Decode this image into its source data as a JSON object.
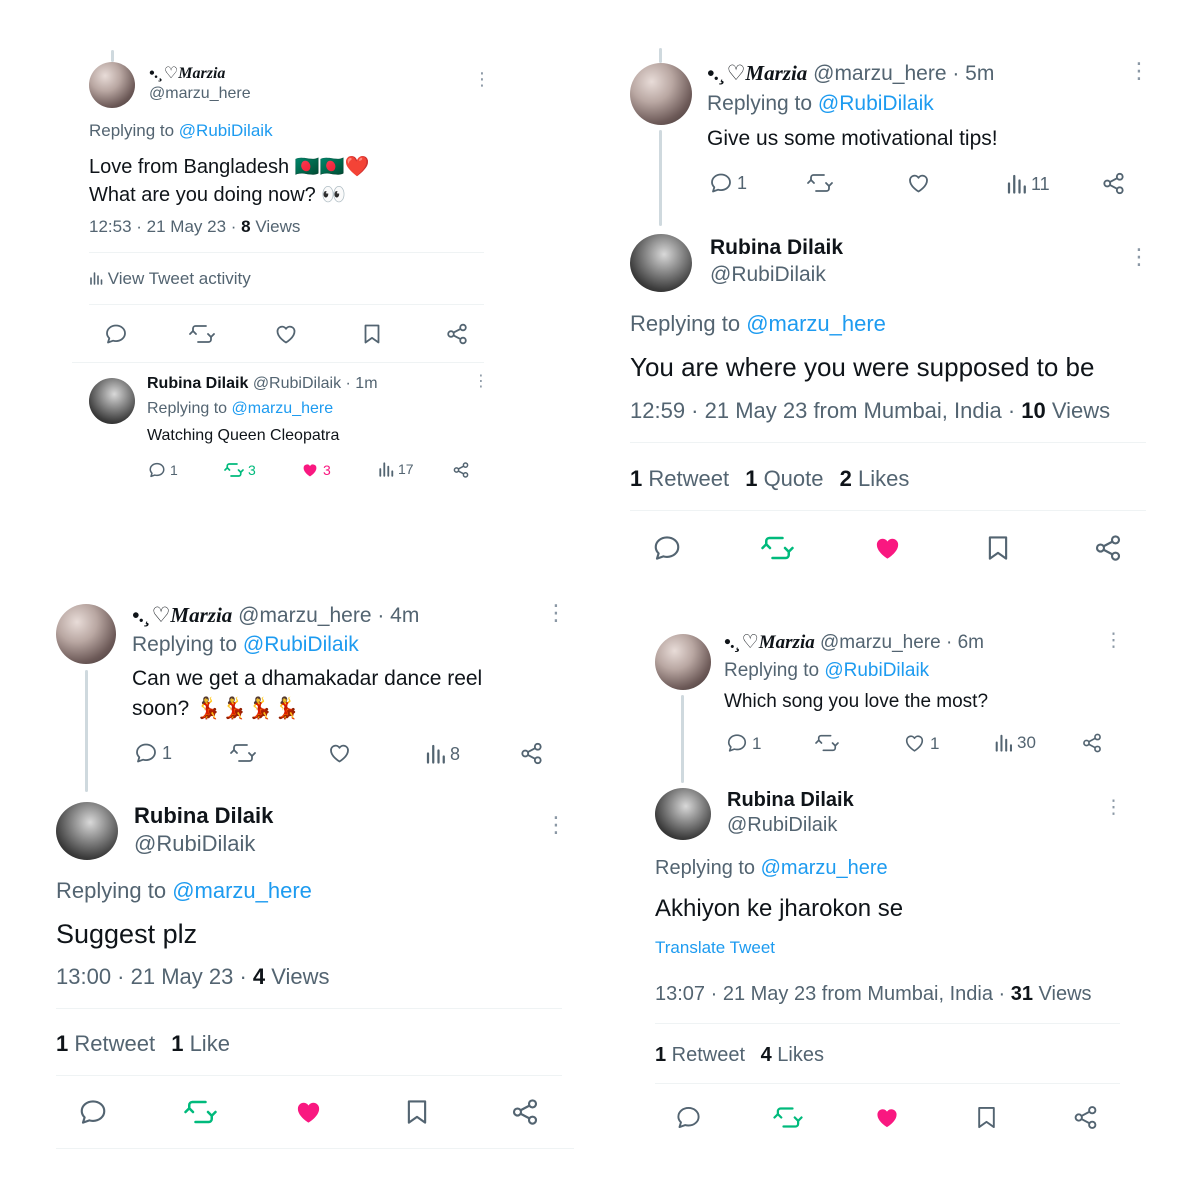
{
  "colors": {
    "text": "#0f1419",
    "secondary": "#536471",
    "link": "#1d9bf0",
    "retweet": "#00ba7c",
    "like": "#f91880",
    "divider": "#eff3f4",
    "thread_line": "#cfd9de"
  },
  "users": {
    "marzia": {
      "name": "•.¸♡Marzia",
      "handle": "@marzu_here"
    },
    "rubina": {
      "name": "Rubina Dilaik",
      "handle": "@RubiDilaik"
    }
  },
  "panel1": {
    "tweet": {
      "replying_prefix": "Replying to ",
      "replying_to": "@RubiDilaik",
      "text_line1": "Love from Bangladesh 🇧🇩🇧🇩❤️",
      "text_line2": "What are you doing now? 👀",
      "meta_time": "12:53 · 21 May 23 · ",
      "views_count": "8",
      "views_label": " Views"
    },
    "activity_label": "View Tweet activity",
    "reply": {
      "time": "· 1m",
      "replying_prefix": "Replying to ",
      "replying_to": "@marzu_here",
      "text": "Watching Queen Cleopatra",
      "replies": "1",
      "retweets": "3",
      "likes": "3",
      "views": "17"
    }
  },
  "panel2": {
    "tweet": {
      "time": "· 5m",
      "replying_prefix": "Replying to ",
      "replying_to": "@RubiDilaik",
      "text": "Give us some motivational tips!",
      "replies": "1",
      "views": "11"
    },
    "reply": {
      "replying_prefix": "Replying to ",
      "replying_to": "@marzu_here",
      "text": "You are where you were supposed to be",
      "meta_time": "12:59 · 21 May 23 from Mumbai, India · ",
      "views_count": "10",
      "views_label": " Views",
      "retweet_count": "1",
      "retweet_label": " Retweet",
      "quote_count": "1",
      "quote_label": " Quote",
      "like_count": "2",
      "like_label": " Likes"
    }
  },
  "panel3": {
    "tweet": {
      "time": "· 4m",
      "replying_prefix": "Replying to ",
      "replying_to": "@RubiDilaik",
      "text_line1": "Can we get a dhamakadar dance reel",
      "text_line2": "soon? 💃💃💃💃",
      "replies": "1",
      "views": "8"
    },
    "reply": {
      "replying_prefix": "Replying to ",
      "replying_to": "@marzu_here",
      "text": "Suggest plz",
      "meta_time": "13:00 · 21 May 23 · ",
      "views_count": "4",
      "views_label": " Views",
      "retweet_count": "1",
      "retweet_label": " Retweet",
      "like_count": "1",
      "like_label": " Like"
    }
  },
  "panel4": {
    "tweet": {
      "time": "· 6m",
      "replying_prefix": "Replying to ",
      "replying_to": "@RubiDilaik",
      "text": "Which song you love the most?",
      "replies": "1",
      "likes": "1",
      "views": "30"
    },
    "reply": {
      "replying_prefix": "Replying to ",
      "replying_to": "@marzu_here",
      "text": "Akhiyon ke jharokon se",
      "translate_label": "Translate Tweet",
      "meta_time": "13:07 · 21 May 23 from Mumbai, India · ",
      "views_count": "31",
      "views_label": " Views",
      "retweet_count": "1",
      "retweet_label": " Retweet",
      "like_count": "4",
      "like_label": " Likes"
    }
  }
}
